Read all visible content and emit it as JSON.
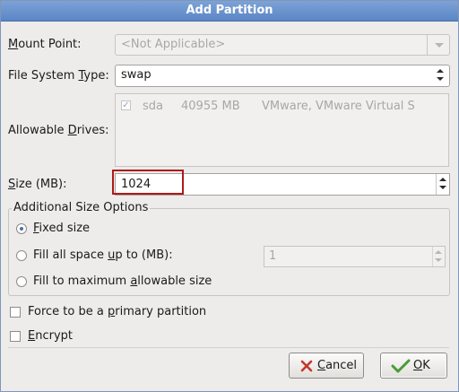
{
  "window": {
    "title": "Add Partition"
  },
  "mount_point": {
    "label_pre": "",
    "label_key": "M",
    "label_post": "ount Point:",
    "value": "<Not Applicable>"
  },
  "fs_type": {
    "label_pre": "File System ",
    "label_key": "T",
    "label_post": "ype:",
    "value": "swap"
  },
  "drives": {
    "label_pre": "Allowable ",
    "label_key": "D",
    "label_post": "rives:",
    "rows": [
      {
        "checked": true,
        "name": "sda",
        "size": "40955 MB",
        "model": "VMware, VMware Virtual S"
      }
    ]
  },
  "size": {
    "label_pre": "",
    "label_key": "S",
    "label_post": "ize (MB):",
    "value": "1024"
  },
  "size_options": {
    "title": "Additional Size Options",
    "fixed": {
      "pre": "",
      "key": "F",
      "post": "ixed size",
      "selected": true
    },
    "fill_up": {
      "pre": "Fill all space ",
      "key": "u",
      "post": "p to (MB):",
      "selected": false,
      "value": "1"
    },
    "fill_max": {
      "pre": "Fill to maximum ",
      "key": "a",
      "post": "llowable size",
      "selected": false
    }
  },
  "primary": {
    "pre": "Force to be a ",
    "key": "p",
    "post": "rimary partition",
    "checked": false
  },
  "encrypt": {
    "pre": "",
    "key": "E",
    "post": "ncrypt",
    "checked": false
  },
  "buttons": {
    "cancel": {
      "pre": "",
      "key": "C",
      "post": "ancel"
    },
    "ok": {
      "pre": "",
      "key": "O",
      "post": "K"
    }
  },
  "colors": {
    "title_bar": "#5a86c6",
    "highlight": "#b01919",
    "cancel_x": "#c0392b",
    "ok_check": "#4a9a3a"
  },
  "icons": {
    "cancel": "x-icon",
    "ok": "check-icon"
  }
}
